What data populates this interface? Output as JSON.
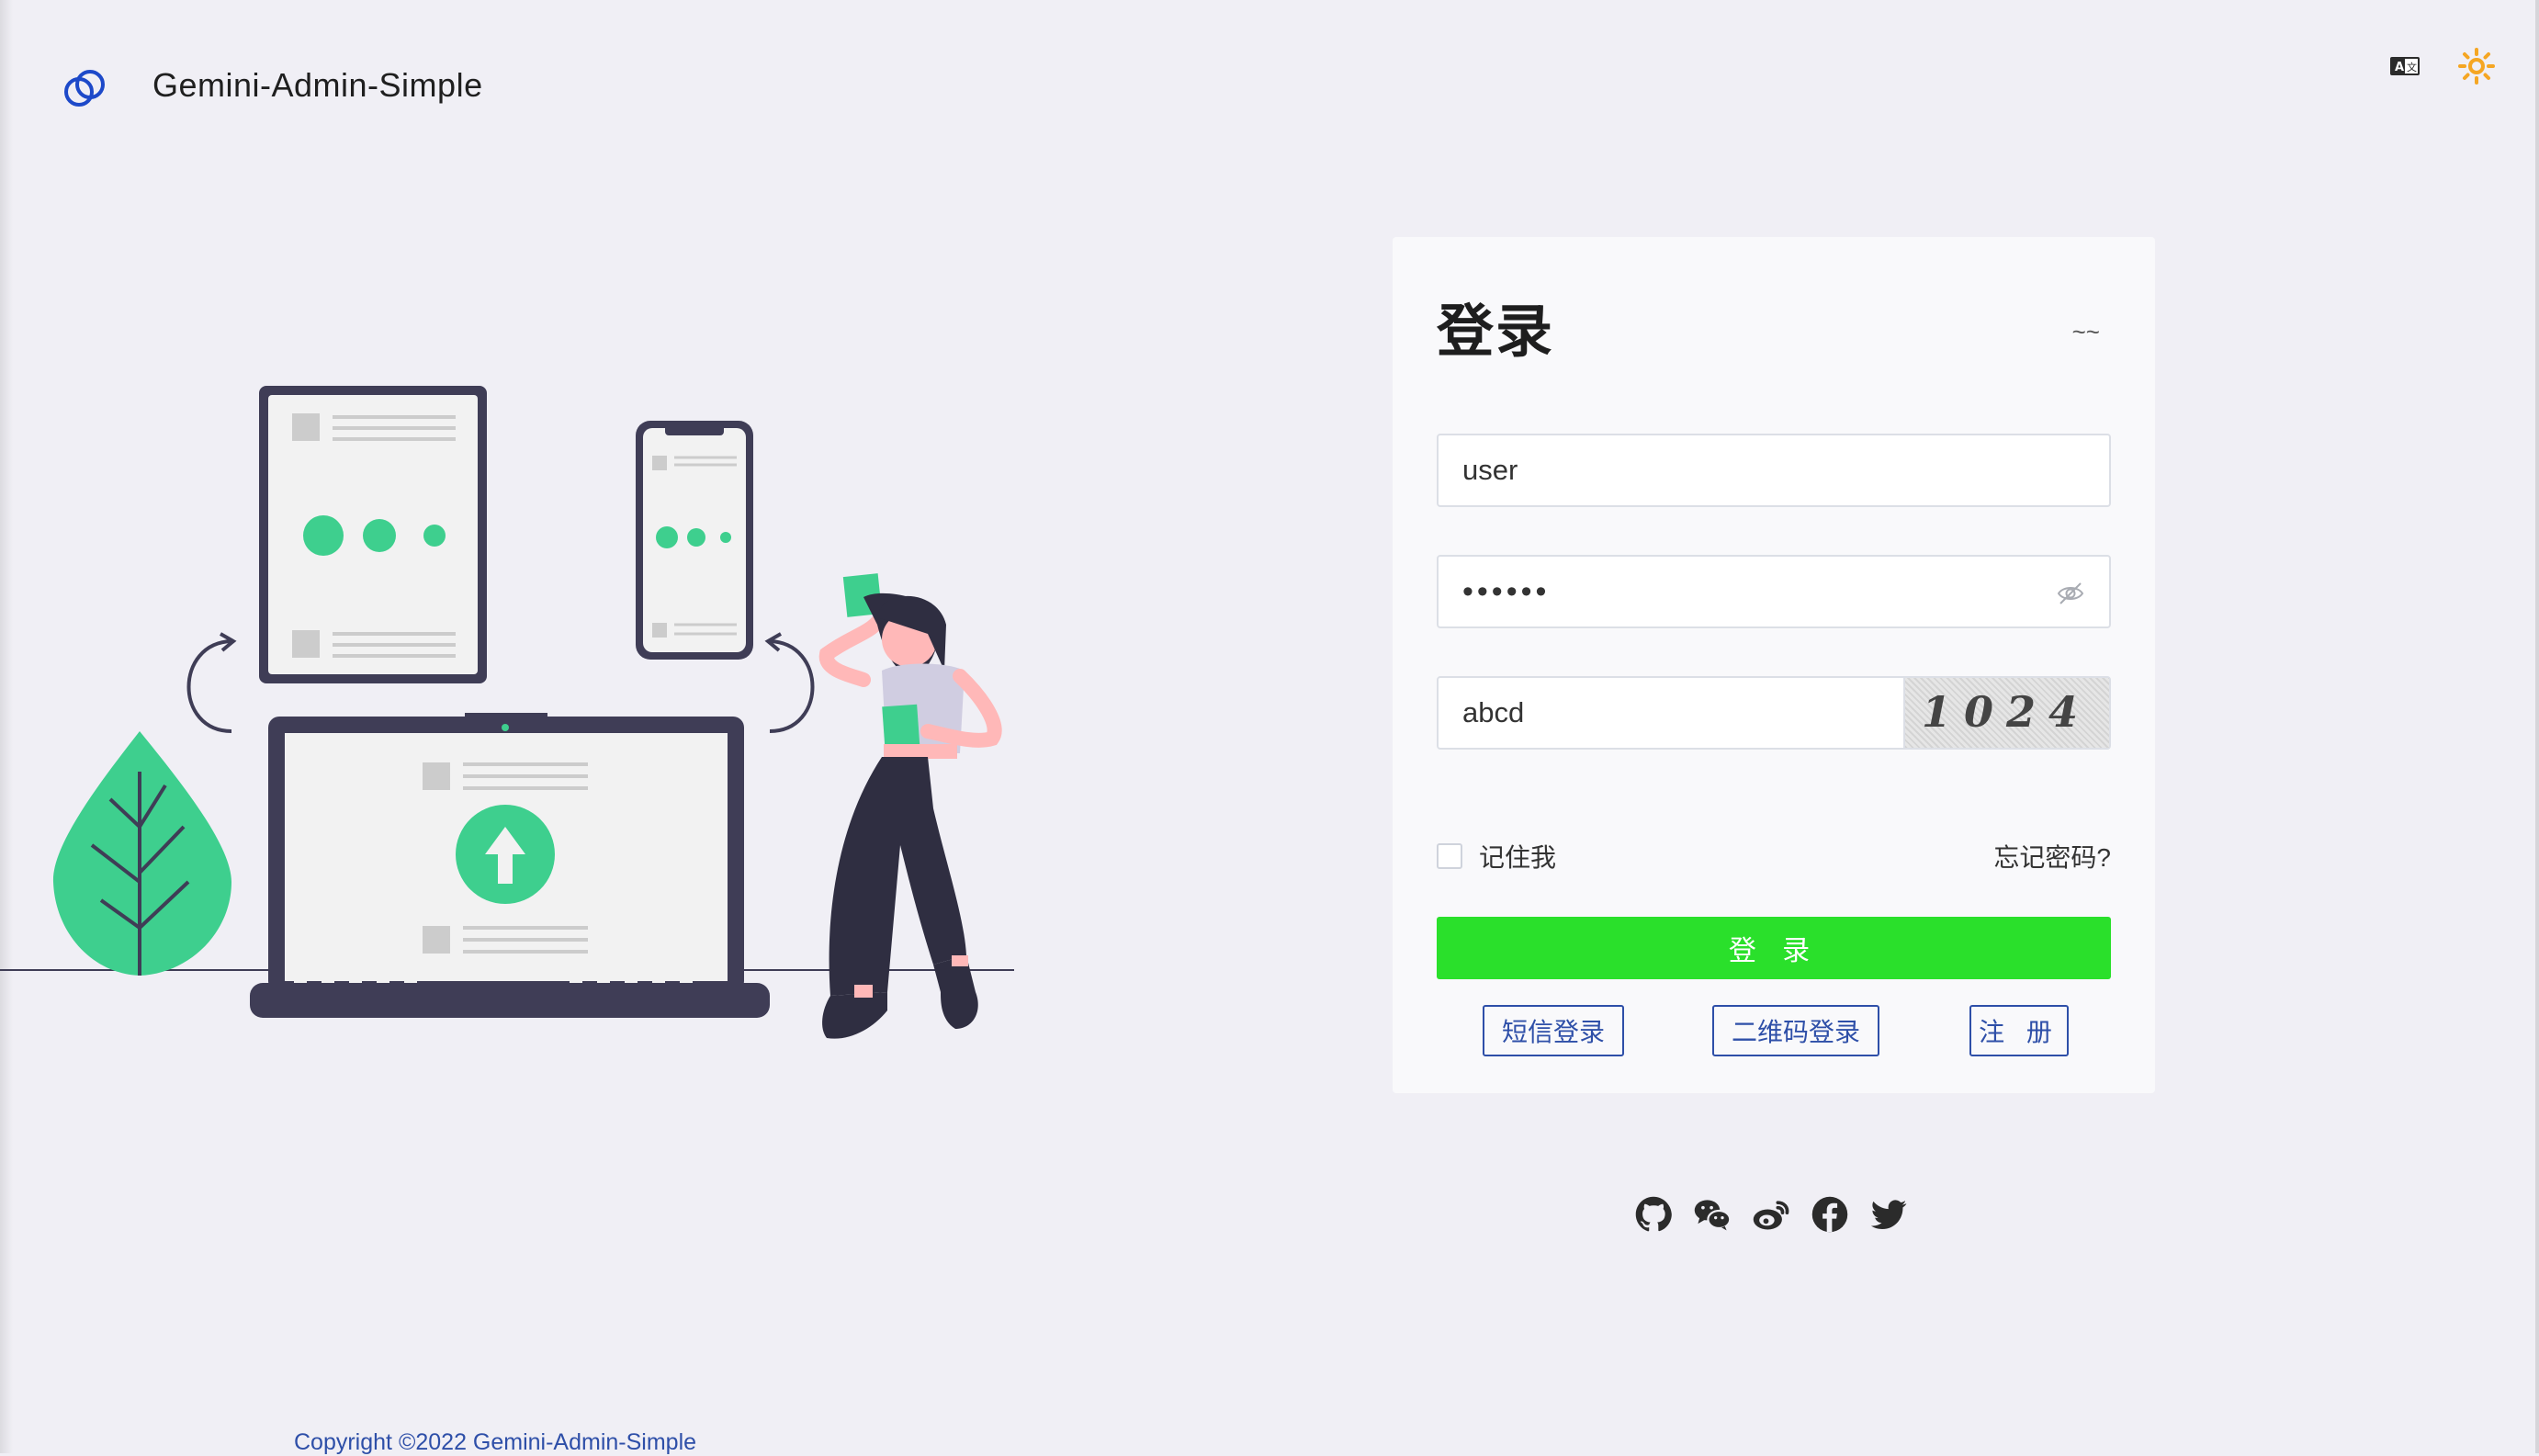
{
  "header": {
    "app_title": "Gemini-Admin-Simple",
    "logo_icon": "gemini-logo-icon",
    "language_icon": "translate-icon",
    "theme_icon": "sun-icon"
  },
  "login": {
    "title": "登录",
    "subtitle": "~~",
    "username_value": "user",
    "password_value": "••••••",
    "captcha_input_value": "abcd",
    "captcha_text": "1024",
    "remember_label": "记住我",
    "forgot_label": "忘记密码?",
    "submit_label": "登 录",
    "sms_login_label": "短信登录",
    "qr_login_label": "二维码登录",
    "register_label": "注 册"
  },
  "social": [
    "github-icon",
    "wechat-icon",
    "weibo-icon",
    "facebook-icon",
    "twitter-icon"
  ],
  "footer": {
    "copyright": "Copyright ©2022 Gemini-Admin-Simple"
  },
  "colors": {
    "background": "#f0eff5",
    "primary_button": "#2ae02b",
    "link_blue": "#2e4fa8",
    "accent_green": "#3ecf8e",
    "theme_icon": "#f5a623"
  }
}
